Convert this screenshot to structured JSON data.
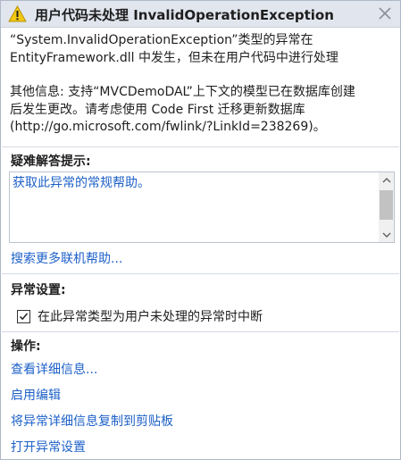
{
  "header": {
    "title": "用户代码未处理 InvalidOperationException",
    "icon": "warning-icon",
    "close_icon": "close-icon"
  },
  "message": {
    "line1": "“System.InvalidOperationException”类型的异常在",
    "line2": "EntityFramework.dll 中发生，但未在用户代码中进行处理",
    "line3": "其他信息: 支持“MVCDemoDAL”上下文的模型已在数据库创建",
    "line4": "后发生更改。请考虑使用 Code First 迁移更新数据库",
    "line5": "(http://go.microsoft.com/fwlink/?LinkId=238269)。"
  },
  "troubleshooting": {
    "title": "疑难解答提示:",
    "tips": [
      "获取此异常的常规帮助。"
    ],
    "more_help": "搜索更多联机帮助..."
  },
  "exception_settings": {
    "title": "异常设置:",
    "checkbox_label": "在此异常类型为用户未处理的异常时中断",
    "checked": true
  },
  "actions": {
    "title": "操作:",
    "items": [
      "查看详细信息...",
      "启用编辑",
      "将异常详细信息复制到剪贴板",
      "打开异常设置"
    ]
  },
  "colors": {
    "link": "#1e61c8",
    "header_bg": "#e1e6ee",
    "warning": "#f2c811"
  }
}
